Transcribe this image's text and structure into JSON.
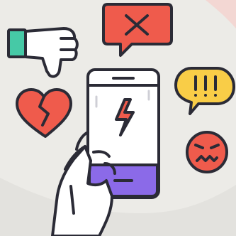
{
  "illustration": {
    "icons": [
      "thumbs-down-icon",
      "close-icon",
      "broken-heart-icon",
      "phone-icon",
      "lightning-icon",
      "exclamation-bubble-icon",
      "angry-face-icon",
      "hand-icon"
    ],
    "colors": {
      "background": "#ecebe7",
      "background_light": "#f6f5f2",
      "outline": "#2b2b36",
      "red": "#ef5b4c",
      "yellow": "#f9cd47",
      "purple": "#8b6ae8",
      "teal": "#46c9a6",
      "white": "#ffffff",
      "pink_accent": "#f3d7d3"
    }
  }
}
